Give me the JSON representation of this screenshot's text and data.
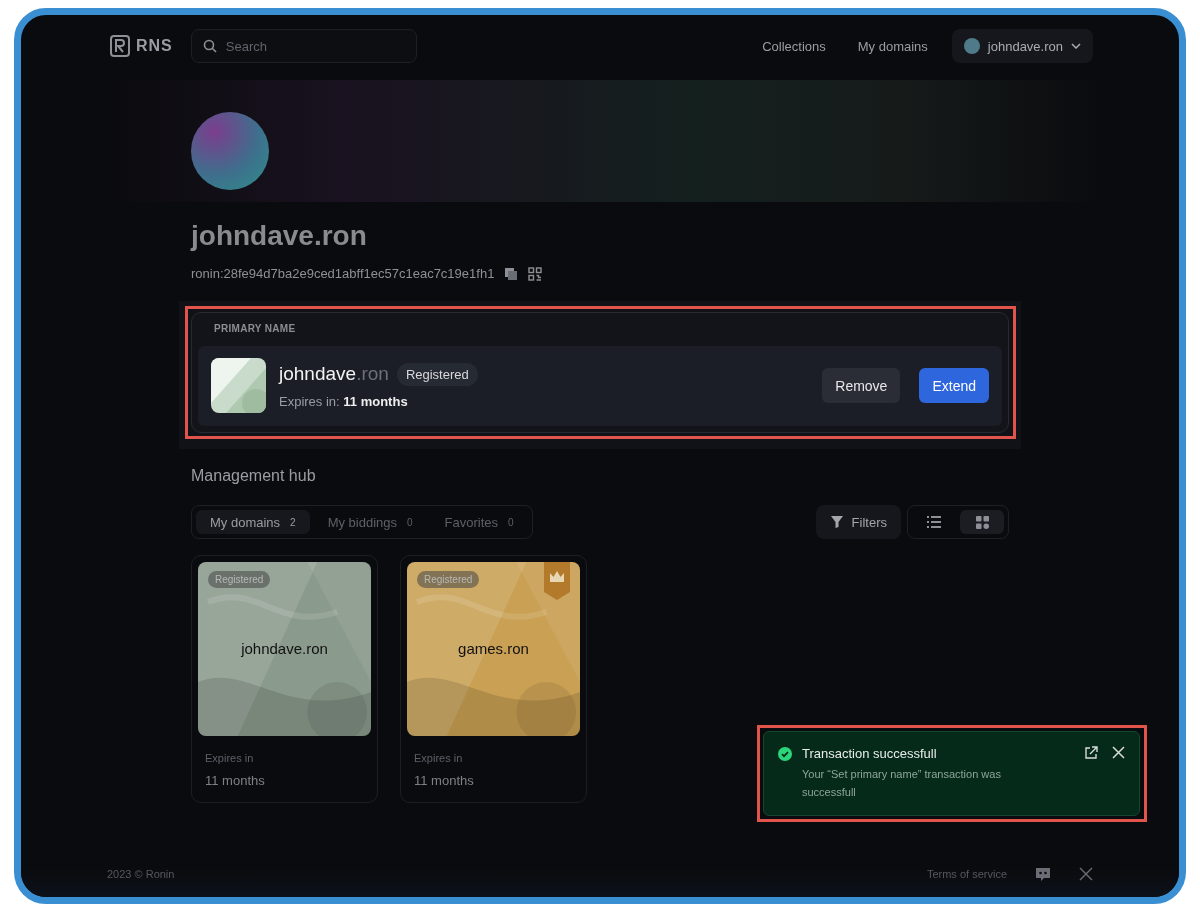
{
  "header": {
    "logo": "RNS",
    "search": {
      "placeholder": "Search"
    },
    "nav": [
      "Collections",
      "My domains"
    ],
    "account": "johndave.ron"
  },
  "profile": {
    "name": "johndave.ron",
    "address": "ronin:28fe94d7ba2e9ced1abff1ec57c1eac7c19e1fh1"
  },
  "primary": {
    "heading": "PRIMARY NAME",
    "name": "johndave",
    "suffix": ".ron",
    "status": "Registered",
    "expires_label": "Expires in:",
    "expires_value": "11 months",
    "buttons": [
      "Remove",
      "Extend"
    ]
  },
  "hub": {
    "title": "Management hub",
    "tabs": [
      {
        "label": "My domains",
        "count": "2",
        "selected": true
      },
      {
        "label": "My biddings",
        "count": "0",
        "selected": false
      },
      {
        "label": "Favorites",
        "count": "0",
        "selected": false
      }
    ],
    "filters": "Filters",
    "views": [
      {
        "kind": "list",
        "selected": false
      },
      {
        "kind": "grid",
        "selected": true
      }
    ],
    "cards": [
      {
        "name": "johndave.ron",
        "status": "Registered",
        "premium": false,
        "color": "#8a9a8c",
        "expires_label": "Expires in",
        "expires_value": "11 months"
      },
      {
        "name": "games.ron",
        "status": "Registered",
        "premium": true,
        "color": "#c9a054",
        "expires_label": "Expires in",
        "expires_value": "11 months"
      }
    ]
  },
  "toast": {
    "title": "Transaction successfull",
    "message": "Your “Set primary name” transaction was successfull"
  },
  "footer": {
    "copyright": "2023 © Ronin",
    "links": [
      "Terms of service"
    ]
  }
}
